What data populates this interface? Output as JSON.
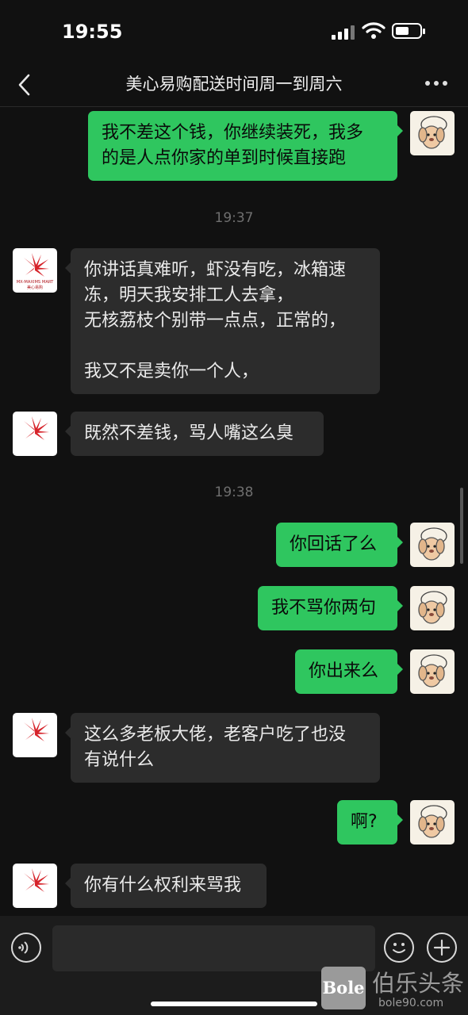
{
  "status_bar": {
    "time": "19:55"
  },
  "nav": {
    "title": "美心易购配送时间周一到周六"
  },
  "store_avatar": {
    "logo_text": "MX-MAXIMS MART",
    "logo_cn": "美心易购"
  },
  "messages": [
    {
      "kind": "out",
      "text": "我不差这个钱，你继续装死，我多\n的是人点你家的单到时候直接跑"
    },
    {
      "kind": "time",
      "text": "19:37"
    },
    {
      "kind": "in",
      "text": "你讲话真难听，虾没有吃，冰箱速\n冻，明天我安排工人去拿，\n无核荔枝个别带一点点，正常的，\n\n我又不是卖你一个人，"
    },
    {
      "kind": "in",
      "text": "既然不差钱，骂人嘴这么臭"
    },
    {
      "kind": "time",
      "text": "19:38"
    },
    {
      "kind": "out",
      "text": "你回话了么"
    },
    {
      "kind": "out",
      "text": "我不骂你两句"
    },
    {
      "kind": "out",
      "text": "你出来么"
    },
    {
      "kind": "in",
      "text": "这么多老板大佬，老客户吃了也没\n有说什么"
    },
    {
      "kind": "out",
      "text": "啊?"
    },
    {
      "kind": "in",
      "text": "你有什么权利来骂我"
    }
  ],
  "input": {
    "placeholder": ""
  },
  "watermark": {
    "badge": "Bole",
    "name": "伯乐头条",
    "url": "bole90.com"
  }
}
